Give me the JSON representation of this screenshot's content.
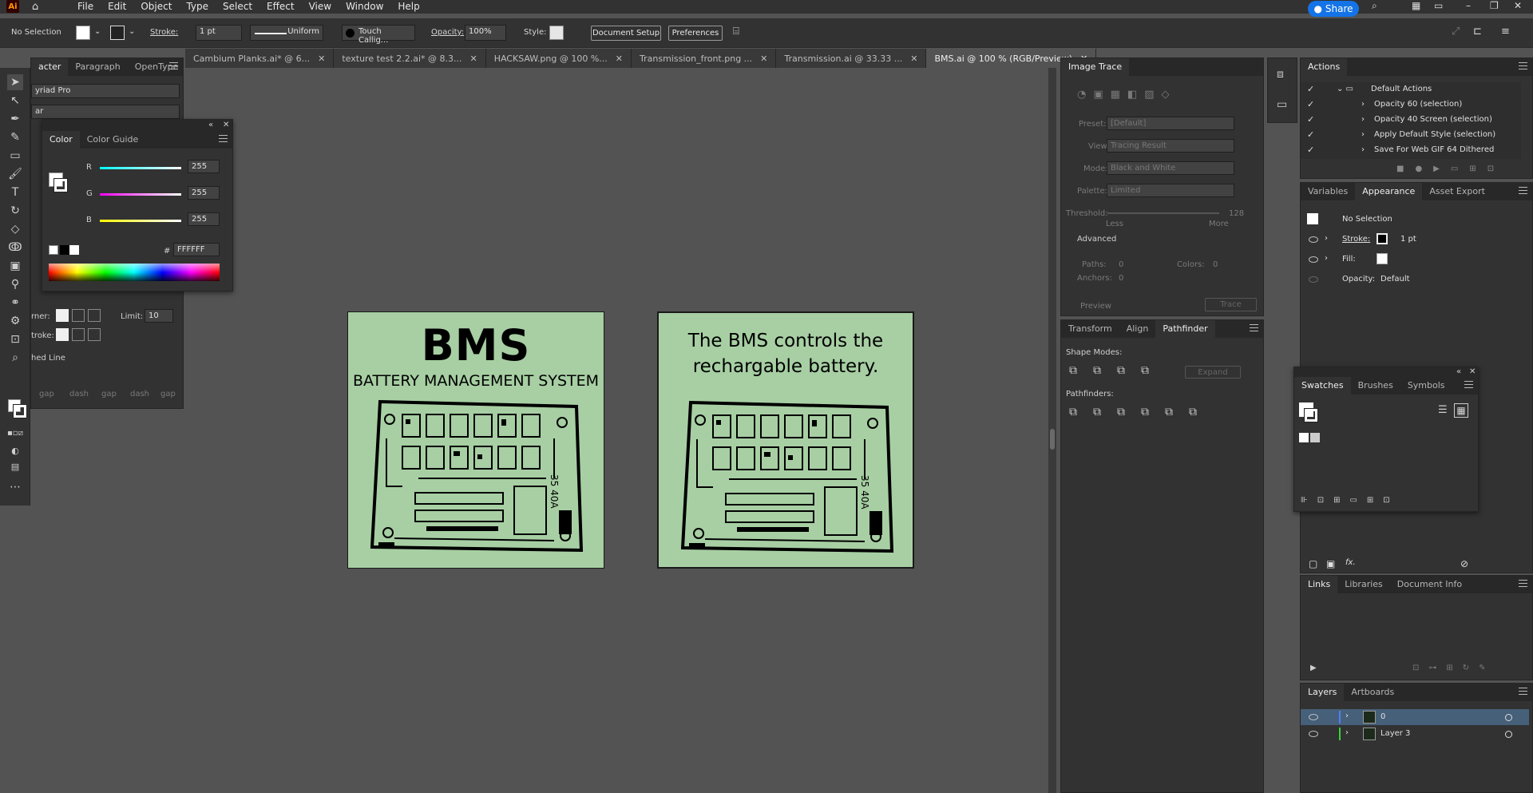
{
  "app": {
    "logo": "Ai",
    "menu": [
      "File",
      "Edit",
      "Object",
      "Type",
      "Select",
      "Effect",
      "View",
      "Window",
      "Help"
    ],
    "share_label": "Share"
  },
  "control": {
    "selection": "No Selection",
    "stroke_label": "Stroke:",
    "stroke_value": "1 pt",
    "profile": "Uniform",
    "brush": "Touch Callig...",
    "opacity_label": "Opacity:",
    "opacity_value": "100%",
    "style_label": "Style:",
    "doc_setup": "Document Setup",
    "preferences": "Preferences"
  },
  "tabs": [
    "Cambium Planks.ai* @ 6...",
    "texture test 2.2.ai* @ 8.3...",
    "HACKSAW.png @ 100 %...",
    "Transmission_front.png ...",
    "Transmission.ai @ 33.33 ...",
    "BMS.ai @ 100 % (RGB/Preview)"
  ],
  "char_panel": {
    "tabs": [
      "acter",
      "Paragraph",
      "OpenType"
    ],
    "font": "yriad Pro",
    "style": "ar",
    "limit_label": "Limit:",
    "limit_value": "10",
    "corner_label": "rner:",
    "stroke_label": "troke:",
    "dashed": "hed Line",
    "dash_labels": [
      "gap",
      "dash",
      "gap",
      "dash",
      "gap"
    ]
  },
  "color_panel": {
    "tabs": [
      "Color",
      "Color Guide"
    ],
    "r_label": "R",
    "g_label": "G",
    "b_label": "B",
    "r": "255",
    "g": "255",
    "b": "255",
    "hex_label": "#",
    "hex": "FFFFFF"
  },
  "artboards": {
    "a1_title": "BMS",
    "a1_sub": "BATTERY MANAGEMENT SYSTEM",
    "a2_line1": "The BMS controls the",
    "a2_line2": "rechargable battery.",
    "board_text": "35 40A"
  },
  "image_trace": {
    "title": "Image Trace",
    "preset_label": "Preset:",
    "preset": "[Default]",
    "view_label": "View:",
    "view": "Tracing Result",
    "mode_label": "Mode:",
    "mode": "Black and White",
    "palette_label": "Palette:",
    "palette": "Limited",
    "threshold_label": "Threshold:",
    "threshold": "128",
    "less": "Less",
    "more": "More",
    "advanced": "Advanced",
    "paths": "Paths:",
    "paths_v": "0",
    "colors": "Colors:",
    "colors_v": "0",
    "anchors": "Anchors:",
    "anchors_v": "0",
    "preview": "Preview",
    "trace": "Trace"
  },
  "pathfinder": {
    "tabs": [
      "Transform",
      "Align",
      "Pathfinder"
    ],
    "shape_modes": "Shape Modes:",
    "expand": "Expand",
    "pathfinders": "Pathfinders:"
  },
  "actions": {
    "title": "Actions",
    "items": [
      "Default Actions",
      "Opacity 60 (selection)",
      "Opacity 40 Screen (selection)",
      "Apply Default Style (selection)",
      "Save For Web GIF 64 Dithered"
    ]
  },
  "appearance": {
    "tabs": [
      "Variables",
      "Appearance",
      "Asset Export"
    ],
    "selection": "No Selection",
    "stroke": "Stroke:",
    "stroke_v": "1 pt",
    "fill": "Fill:",
    "opacity": "Opacity:",
    "opacity_v": "Default",
    "fx": "fx."
  },
  "swatches": {
    "tabs": [
      "Swatches",
      "Brushes",
      "Symbols"
    ]
  },
  "links": {
    "tabs": [
      "Links",
      "Libraries",
      "Document Info"
    ]
  },
  "layers": {
    "tabs": [
      "Layers",
      "Artboards"
    ],
    "items": [
      "0",
      "Layer 3"
    ]
  }
}
